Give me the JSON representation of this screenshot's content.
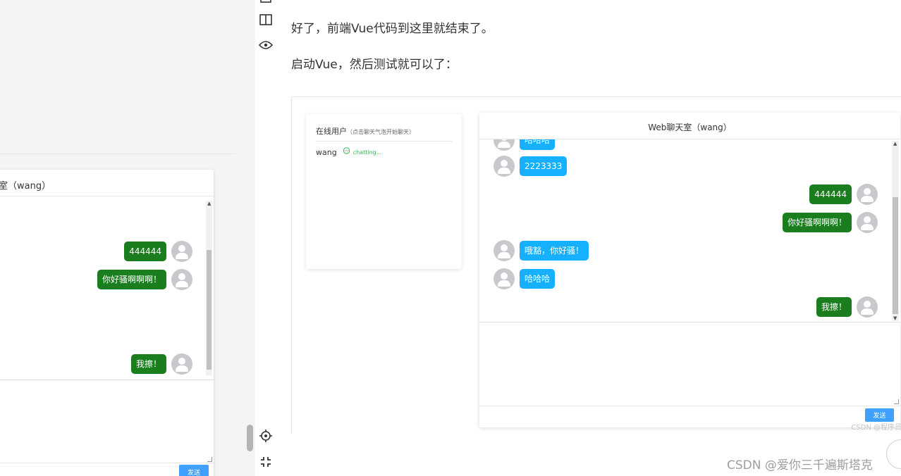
{
  "left_preview": {
    "chat_title": "室（wang）",
    "messages": [
      {
        "side": "right",
        "text": "444444",
        "color": "green"
      },
      {
        "side": "right",
        "text": "你好骚啊啊啊！",
        "color": "green"
      },
      {
        "side": "right",
        "text": "我擦！",
        "color": "green"
      }
    ],
    "send_label": "发送"
  },
  "toolbar": {
    "icons": [
      "split-view-icon",
      "eye-icon",
      "locate-icon",
      "fullscreen-icon"
    ]
  },
  "article": {
    "para1": "好了，前端Vue代码到这里就结束了。",
    "para2": "启动Vue，然后测试就可以了："
  },
  "screenshot": {
    "online_title": "在线用户",
    "online_hint": "（点击聊天气泡开始聊天）",
    "online_user": "wang",
    "online_status": "chatting...",
    "chat_title": "Web聊天室（wang）",
    "messages": [
      {
        "side": "left",
        "text": "哈哈哈",
        "color": "blue"
      },
      {
        "side": "left",
        "text": "2223333",
        "color": "blue"
      },
      {
        "side": "right",
        "text": "444444",
        "color": "green"
      },
      {
        "side": "right",
        "text": "你好骚啊啊啊！",
        "color": "green"
      },
      {
        "side": "left",
        "text": "哦豁，你好骚！",
        "color": "blue"
      },
      {
        "side": "left",
        "text": "哈哈哈",
        "color": "blue"
      },
      {
        "side": "right",
        "text": "我擦！",
        "color": "green"
      }
    ],
    "send_label": "发送",
    "watermark": "CSDN @程序员"
  },
  "page_watermark": "CSDN @爱你三千遍斯塔克",
  "colors": {
    "self_bubble": "#1a7d1e",
    "other_bubble": "#16b0ff",
    "send_button": "#40a0ff"
  }
}
